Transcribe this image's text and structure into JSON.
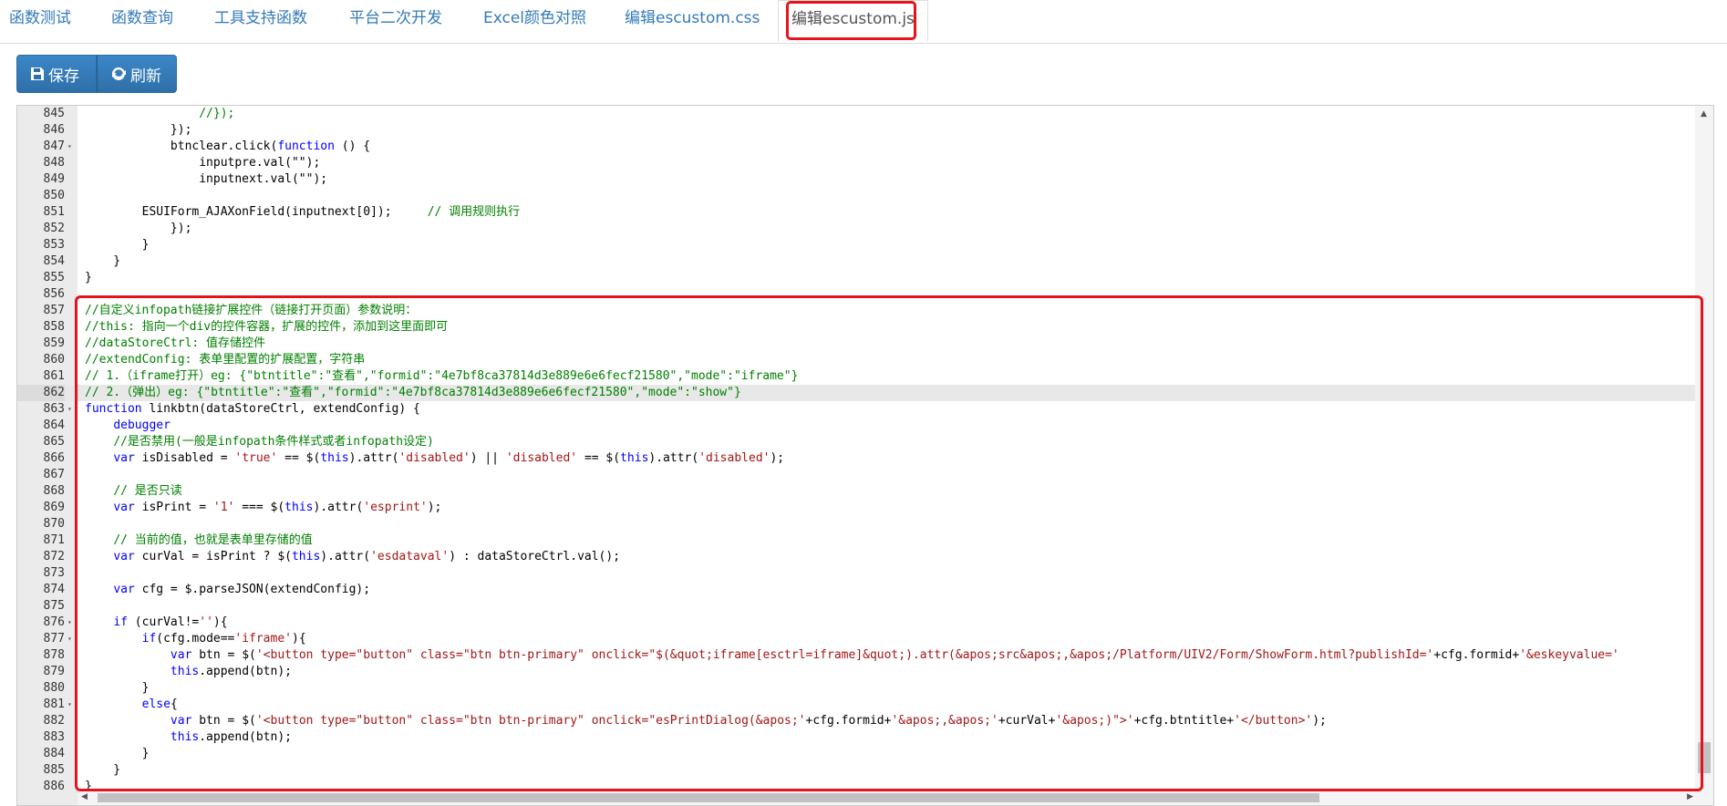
{
  "tabs": [
    {
      "label": "函数测试"
    },
    {
      "label": "函数查询"
    },
    {
      "label": "工具支持函数"
    },
    {
      "label": "平台二次开发"
    },
    {
      "label": "Excel颜色对照"
    },
    {
      "label": "编辑escustom.css"
    },
    {
      "label": "编辑escustom.js",
      "active": true
    }
  ],
  "toolbar": {
    "save_label": "保存",
    "refresh_label": "刷新"
  },
  "editor": {
    "active_line": "862",
    "lines": [
      {
        "num": "845",
        "fold": "",
        "text": "                //});"
      },
      {
        "num": "846",
        "fold": "",
        "text": "            });"
      },
      {
        "num": "847",
        "fold": "▾",
        "text": "            btnclear.click(function () {"
      },
      {
        "num": "848",
        "fold": "",
        "text": "                inputpre.val(\"\");"
      },
      {
        "num": "849",
        "fold": "",
        "text": "                inputnext.val(\"\");"
      },
      {
        "num": "850",
        "fold": "",
        "text": ""
      },
      {
        "num": "851",
        "fold": "",
        "text": "        ESUIForm_AJAXonField(inputnext[0]);     // 调用规则执行"
      },
      {
        "num": "852",
        "fold": "",
        "text": "            });"
      },
      {
        "num": "853",
        "fold": "",
        "text": "        }"
      },
      {
        "num": "854",
        "fold": "",
        "text": "    }"
      },
      {
        "num": "855",
        "fold": "",
        "text": "}"
      },
      {
        "num": "856",
        "fold": "",
        "text": ""
      },
      {
        "num": "857",
        "fold": "",
        "text": "//自定义infopath链接扩展控件（链接打开页面）参数说明："
      },
      {
        "num": "858",
        "fold": "",
        "text": "//this: 指向一个div的控件容器，扩展的控件，添加到这里面即可"
      },
      {
        "num": "859",
        "fold": "",
        "text": "//dataStoreCtrl: 值存储控件"
      },
      {
        "num": "860",
        "fold": "",
        "text": "//extendConfig: 表单里配置的扩展配置，字符串"
      },
      {
        "num": "861",
        "fold": "",
        "text": "// 1.（iframe打开）eg: {\"btntitle\":\"查看\",\"formid\":\"4e7bf8ca37814d3e889e6e6fecf21580\",\"mode\":\"iframe\"}"
      },
      {
        "num": "862",
        "fold": "",
        "text": "// 2.（弹出）eg: {\"btntitle\":\"查看\",\"formid\":\"4e7bf8ca37814d3e889e6e6fecf21580\",\"mode\":\"show\"}"
      },
      {
        "num": "863",
        "fold": "▾",
        "text": "function linkbtn(dataStoreCtrl, extendConfig) {"
      },
      {
        "num": "864",
        "fold": "",
        "text": "    debugger"
      },
      {
        "num": "865",
        "fold": "",
        "text": "    //是否禁用(一般是infopath条件样式或者infopath设定)"
      },
      {
        "num": "866",
        "fold": "",
        "text": "    var isDisabled = 'true' == $(this).attr('disabled') || 'disabled' == $(this).attr('disabled');"
      },
      {
        "num": "867",
        "fold": "",
        "text": ""
      },
      {
        "num": "868",
        "fold": "",
        "text": "    // 是否只读"
      },
      {
        "num": "869",
        "fold": "",
        "text": "    var isPrint = '1' === $(this).attr('esprint');"
      },
      {
        "num": "870",
        "fold": "",
        "text": ""
      },
      {
        "num": "871",
        "fold": "",
        "text": "    // 当前的值，也就是表单里存储的值"
      },
      {
        "num": "872",
        "fold": "",
        "text": "    var curVal = isPrint ? $(this).attr('esdataval') : dataStoreCtrl.val();"
      },
      {
        "num": "873",
        "fold": "",
        "text": ""
      },
      {
        "num": "874",
        "fold": "",
        "text": "    var cfg = $.parseJSON(extendConfig);"
      },
      {
        "num": "875",
        "fold": "",
        "text": ""
      },
      {
        "num": "876",
        "fold": "▾",
        "text": "    if (curVal!=''){"
      },
      {
        "num": "877",
        "fold": "▾",
        "text": "        if(cfg.mode=='iframe'){"
      },
      {
        "num": "878",
        "fold": "",
        "text": "            var btn = $('<button type=\"button\" class=\"btn btn-primary\" onclick=\"$(&quot;iframe[esctrl=iframe]&quot;).attr(&apos;src&apos;,&apos;/Platform/UIV2/Form/ShowForm.html?publishId='+cfg.formid+'&eskeyvalue='"
      },
      {
        "num": "879",
        "fold": "",
        "text": "            this.append(btn);"
      },
      {
        "num": "880",
        "fold": "",
        "text": "        }"
      },
      {
        "num": "881",
        "fold": "▾",
        "text": "        else{"
      },
      {
        "num": "882",
        "fold": "",
        "text": "            var btn = $('<button type=\"button\" class=\"btn btn-primary\" onclick=\"esPrintDialog(&apos;'+cfg.formid+'&apos;,&apos;'+curVal+'&apos;)\">'+cfg.btntitle+'</button>');"
      },
      {
        "num": "883",
        "fold": "",
        "text": "            this.append(btn);"
      },
      {
        "num": "884",
        "fold": "",
        "text": "        }"
      },
      {
        "num": "885",
        "fold": "",
        "text": "    }"
      },
      {
        "num": "886",
        "fold": "",
        "text": "}"
      }
    ]
  },
  "colors": {
    "tab_link": "#337ab7",
    "button_bg": "#337ab7",
    "highlight_border": "#e5141c",
    "comment": "#008000",
    "keyword": "#0000ff",
    "string": "#a31515"
  }
}
